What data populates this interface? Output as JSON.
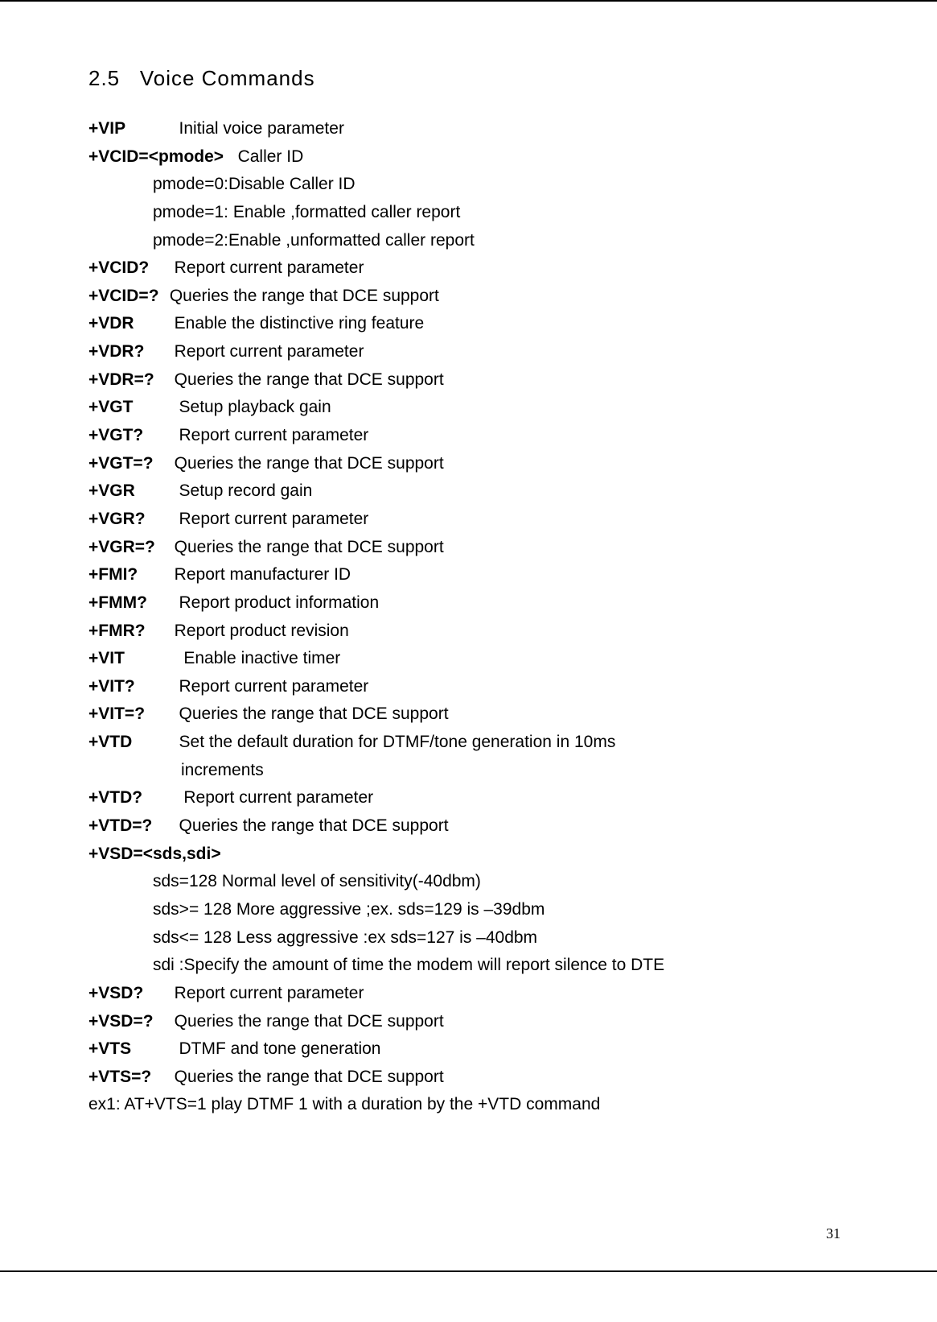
{
  "section_number": "2.5",
  "section_title": "Voice Commands",
  "commands": {
    "vip": {
      "cmd": "+VIP",
      "desc": "Initial voice parameter"
    },
    "vcid_set": {
      "cmd": "+VCID=<pmode>",
      "desc": "Caller ID"
    },
    "vcid_p0": "pmode=0:Disable Caller ID",
    "vcid_p1": "pmode=1: Enable ,formatted caller report",
    "vcid_p2": "pmode=2:Enable ,unformatted caller report",
    "vcid_q": {
      "cmd": "+VCID?",
      "desc": "Report current parameter"
    },
    "vcid_r": {
      "cmd": "+VCID=?",
      "desc": "Queries the range that DCE support"
    },
    "vdr": {
      "cmd": "+VDR",
      "desc": "Enable the distinctive ring feature"
    },
    "vdr_q": {
      "cmd": "+VDR?",
      "desc": "Report current parameter"
    },
    "vdr_r": {
      "cmd": "+VDR=?",
      "desc": "Queries the range that DCE support"
    },
    "vgt": {
      "cmd": "+VGT",
      "desc": "Setup playback gain"
    },
    "vgt_q": {
      "cmd": "+VGT?",
      "desc": "Report current parameter"
    },
    "vgt_r": {
      "cmd": "+VGT=?",
      "desc": "Queries the range that DCE support"
    },
    "vgr": {
      "cmd": "+VGR",
      "desc": "Setup record gain"
    },
    "vgr_q": {
      "cmd": "+VGR?",
      "desc": "Report current parameter"
    },
    "vgr_r": {
      "cmd": "+VGR=?",
      "desc": "Queries the range that DCE support"
    },
    "fmi_q": {
      "cmd": "+FMI?",
      "desc": "Report manufacturer ID"
    },
    "fmm_q": {
      "cmd": "+FMM?",
      "desc": "Report product information"
    },
    "fmr_q": {
      "cmd": "+FMR?",
      "desc": "Report product revision"
    },
    "vit": {
      "cmd": "+VIT",
      "desc": "Enable inactive timer"
    },
    "vit_q": {
      "cmd": "+VIT?",
      "desc": "Report current parameter"
    },
    "vit_r": {
      "cmd": "+VIT=?",
      "desc": "Queries the range that DCE support"
    },
    "vtd": {
      "cmd": "+VTD",
      "desc": "Set the default duration for DTMF/tone generation in 10ms"
    },
    "vtd_cont": "increments",
    "vtd_q": {
      "cmd": "+VTD?",
      "desc": "Report current parameter"
    },
    "vtd_r": {
      "cmd": "+VTD=?",
      "desc": "Queries the range that DCE support"
    },
    "vsd_set": {
      "cmd": "+VSD=<sds,sdi>"
    },
    "vsd_l1": "sds=128 Normal level of sensitivity(-40dbm)",
    "vsd_l2": "sds>= 128 More aggressive ;ex. sds=129 is –39dbm",
    "vsd_l3": "sds<= 128 Less aggressive :ex sds=127 is –40dbm",
    "vsd_l4": "sdi :Specify the amount of time the modem will report silence to DTE",
    "vsd_q": {
      "cmd": "+VSD?",
      "desc": "Report current parameter"
    },
    "vsd_r": {
      "cmd": "+VSD=?",
      "desc": "Queries the range that DCE support"
    },
    "vts": {
      "cmd": "+VTS",
      "desc": "DTMF and tone generation"
    },
    "vts_r": {
      "cmd": "+VTS=?",
      "desc": "Queries the range that DCE support"
    },
    "ex1": "ex1:   AT+VTS=1 play DTMF 1 with a duration by the +VTD command"
  },
  "page_number": "31"
}
